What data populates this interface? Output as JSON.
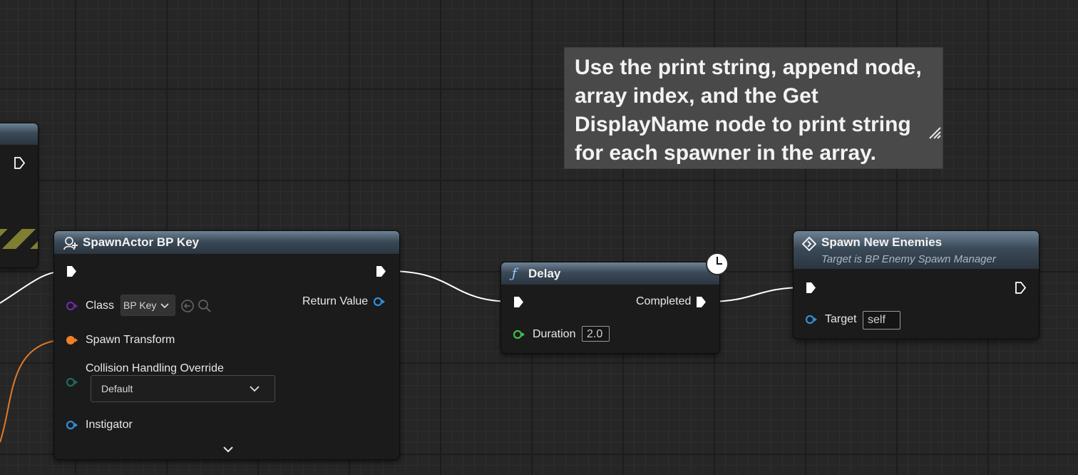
{
  "comment": {
    "text": "Use the print string, append node, array index, and the Get DisplayName node to print string for each spawner in the array."
  },
  "spawn_actor_node": {
    "title": "SpawnActor BP Key",
    "class_label": "Class",
    "class_value": "BP Key",
    "return_value_label": "Return Value",
    "spawn_transform_label": "Spawn Transform",
    "collision_label": "Collision Handling Override",
    "collision_value": "Default",
    "instigator_label": "Instigator"
  },
  "delay_node": {
    "title": "Delay",
    "completed_label": "Completed",
    "duration_label": "Duration",
    "duration_value": "2.0"
  },
  "spawn_enemies_node": {
    "title": "Spawn New Enemies",
    "subtitle": "Target is BP Enemy Spawn Manager",
    "target_label": "Target",
    "target_value": "self"
  },
  "colors": {
    "exec_pin": "#ffffff",
    "object_pin": "#2f8fd8",
    "class_pin": "#6a2ba0",
    "transform_pin": "#f07f2a",
    "enum_pin": "#1f6b60",
    "float_pin": "#3fbf4a",
    "wire_exec": "#ffffff",
    "wire_transform": "#e07a2a",
    "hazard_stripe": "#7f7f32"
  }
}
